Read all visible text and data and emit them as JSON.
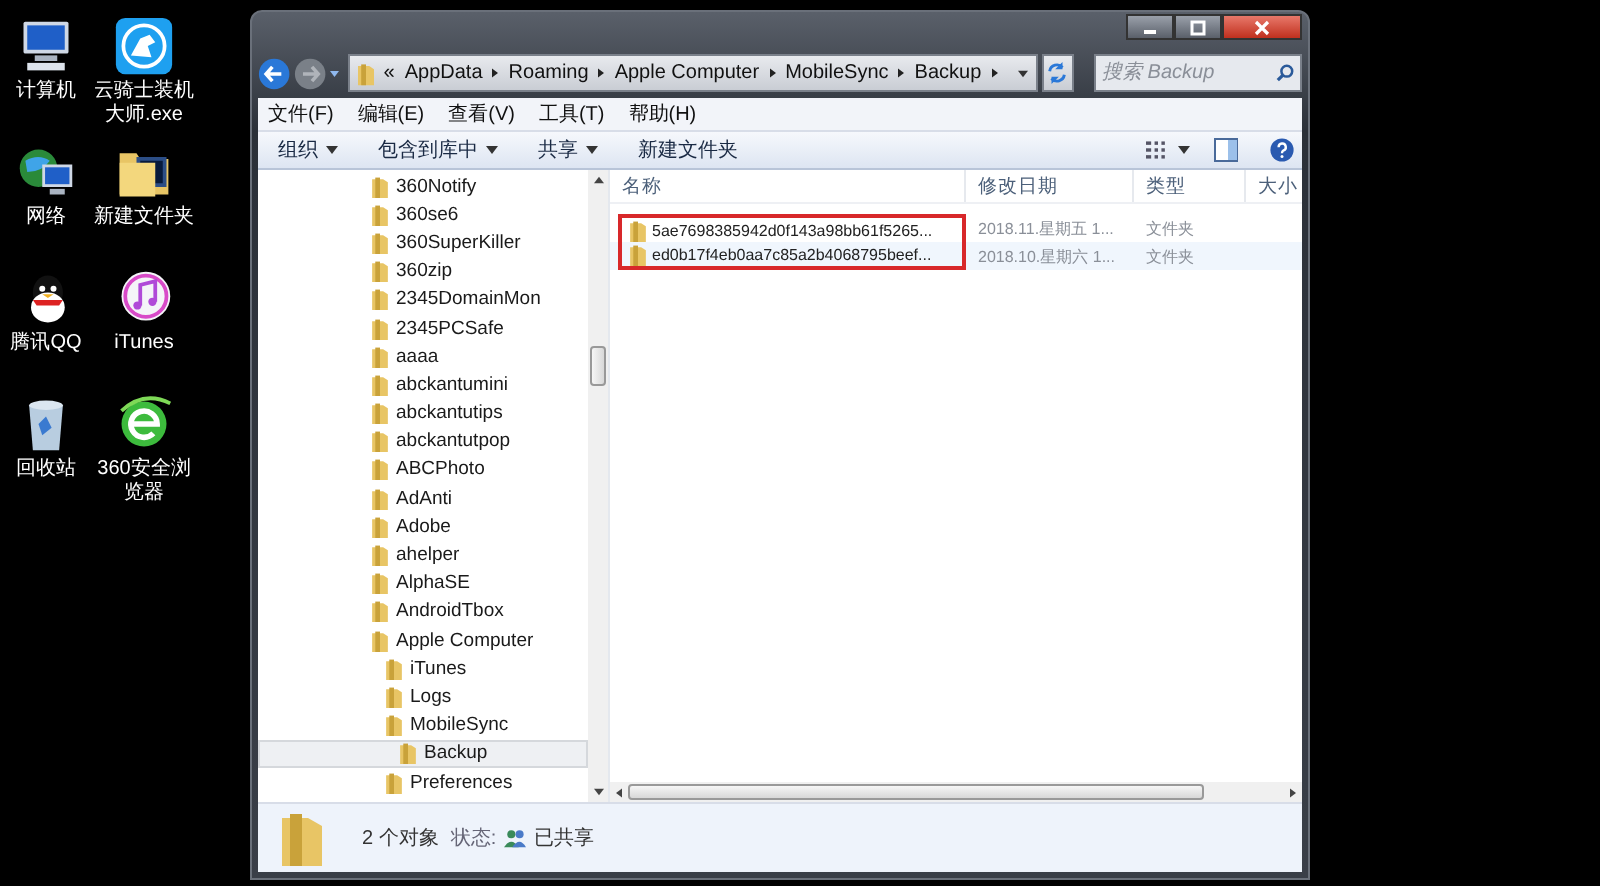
{
  "desktop_icons": [
    {
      "label": "计算机",
      "kind": "computer"
    },
    {
      "label": "云骑士装机大师.exe",
      "kind": "knight-app"
    },
    {
      "label": "网络",
      "kind": "network"
    },
    {
      "label": "新建文件夹",
      "kind": "folder"
    },
    {
      "label": "腾讯QQ",
      "kind": "penguin"
    },
    {
      "label": "iTunes",
      "kind": "music"
    },
    {
      "label": "回收站",
      "kind": "bin"
    },
    {
      "label": "360安全浏览器",
      "kind": "browser"
    }
  ],
  "window": {
    "address_overflow": "«",
    "address_path": [
      "AppData",
      "Roaming",
      "Apple Computer",
      "MobileSync",
      "Backup"
    ],
    "search": {
      "placeholder": "搜索 Backup"
    },
    "menu": [
      "文件(F)",
      "编辑(E)",
      "查看(V)",
      "工具(T)",
      "帮助(H)"
    ],
    "toolbar": [
      {
        "label": "组织",
        "dropdown": true
      },
      {
        "label": "包含到库中",
        "dropdown": true
      },
      {
        "label": "共享",
        "dropdown": true
      },
      {
        "label": "新建文件夹",
        "dropdown": false
      }
    ],
    "nav_tree": [
      {
        "label": "360Notify",
        "selected": false
      },
      {
        "label": "360se6",
        "selected": false
      },
      {
        "label": "360SuperKiller",
        "selected": false
      },
      {
        "label": "360zip",
        "selected": false
      },
      {
        "label": "2345DomainMon",
        "selected": false
      },
      {
        "label": "2345PCSafe",
        "selected": false
      },
      {
        "label": "aaaa",
        "selected": false
      },
      {
        "label": "abckantumini",
        "selected": false
      },
      {
        "label": "abckantutips",
        "selected": false
      },
      {
        "label": "abckantutpop",
        "selected": false
      },
      {
        "label": "ABCPhoto",
        "selected": false
      },
      {
        "label": "AdAnti",
        "selected": false
      },
      {
        "label": "Adobe",
        "selected": false
      },
      {
        "label": "ahelper",
        "selected": false
      },
      {
        "label": "AlphaSE",
        "selected": false
      },
      {
        "label": "AndroidTbox",
        "selected": false
      },
      {
        "label": "Apple Computer",
        "selected": false,
        "children": [
          {
            "label": "iTunes",
            "selected": false
          },
          {
            "label": "Logs",
            "selected": false
          },
          {
            "label": "MobileSync",
            "selected": false,
            "children": [
              {
                "label": "Backup",
                "selected": true
              }
            ]
          },
          {
            "label": "Preferences",
            "selected": false
          }
        ]
      }
    ],
    "columns": [
      "名称",
      "修改日期",
      "类型",
      "大小"
    ],
    "files": [
      {
        "name": "5ae7698385942d0f143a98bb61f5265...",
        "modified": "2018.11.星期五 1...",
        "type": "文件夹",
        "selected": false
      },
      {
        "name": "ed0b17f4eb0aa7c85a2b4068795beef...",
        "modified": "2018.10.星期六 1...",
        "type": "文件夹",
        "selected": true
      }
    ],
    "status": {
      "count": "2 个对象",
      "state_label": "状态:",
      "state": "已共享"
    }
  }
}
